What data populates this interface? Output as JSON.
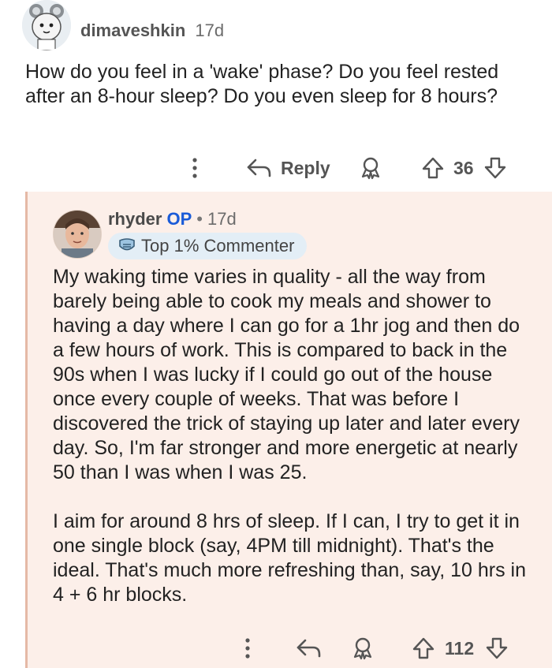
{
  "comment1": {
    "username": "dimaveshkin",
    "time": "17d",
    "text": "How do you feel in a 'wake' phase? Do you feel rested after an 8-hour sleep? Do you even sleep for 8 hours?",
    "reply_label": "Reply",
    "vote_count": "36"
  },
  "comment2": {
    "username": "rhyder",
    "op_label": "OP",
    "separator": "•",
    "time": "17d",
    "badge_label": "Top 1% Commenter",
    "paragraphs": [
      "My waking time varies in quality - all the way from barely being able to cook my meals and shower to having a day where I can go for a 1hr jog and then do a few hours of work. This is compared to back in the 90s when I was lucky if I could go out of the house once every couple of weeks. That was before I discovered the trick of staying up later and later every day. So, I'm far stronger and more energetic at nearly 50 than I was when I was 25.",
      "I aim for around 8 hrs of sleep. If I can, I try to get it in one single block (say, 4PM till midnight). That's the ideal. That's much more refreshing than, say, 10 hrs in 4 + 6 hr blocks."
    ],
    "vote_count": "112"
  },
  "icons": {
    "more": "more-vertical-icon",
    "reply": "reply-arrow-icon",
    "award": "award-icon",
    "upvote": "upvote-arrow-icon",
    "downvote": "downvote-arrow-icon",
    "badge": "commenter-badge-icon"
  },
  "colors": {
    "op_blue": "#1a5bd8",
    "reply_bg": "#fcefe9",
    "thread_line": "#e5b9a6",
    "badge_bg": "#e3eef6"
  }
}
